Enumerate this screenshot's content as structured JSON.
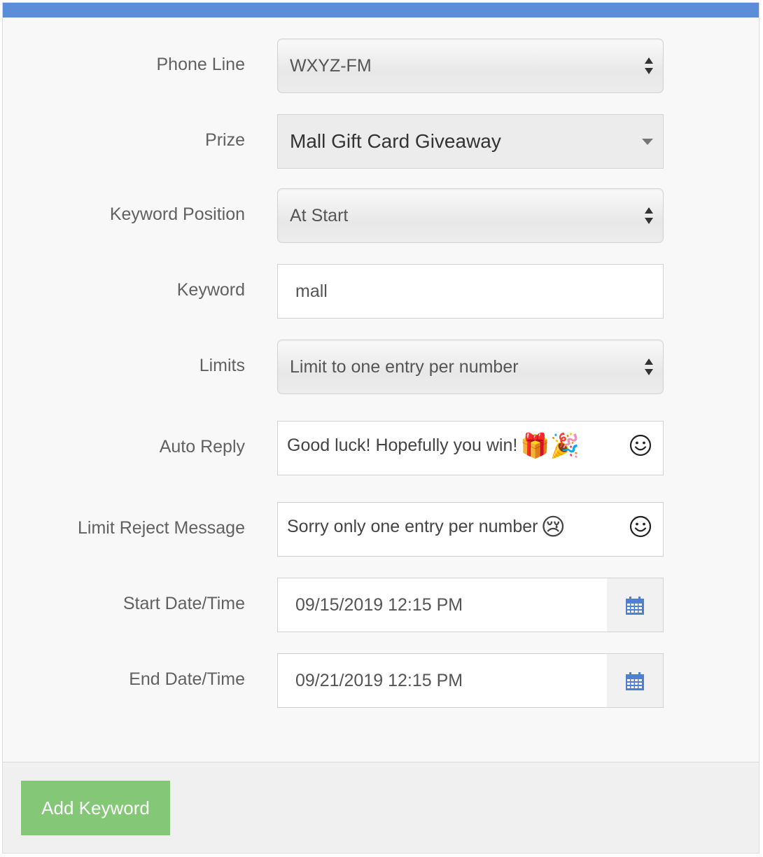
{
  "form": {
    "phone_line": {
      "label": "Phone Line",
      "value": "WXYZ-FM"
    },
    "prize": {
      "label": "Prize",
      "value": "Mall Gift Card Giveaway"
    },
    "keyword_position": {
      "label": "Keyword Position",
      "value": "At Start"
    },
    "keyword": {
      "label": "Keyword",
      "value": "mall"
    },
    "limits": {
      "label": "Limits",
      "value": "Limit to one entry per number"
    },
    "auto_reply": {
      "label": "Auto Reply",
      "value": "Good luck! Hopefully you win!",
      "emoji": "🎁🎉",
      "emoji_picker_icon": "smiley-icon"
    },
    "limit_reject": {
      "label": "Limit Reject Message",
      "value": "Sorry only one entry per number",
      "emoji": "😢",
      "emoji_picker_icon": "smiley-icon"
    },
    "start": {
      "label": "Start Date/Time",
      "value": "09/15/2019 12:15 PM",
      "icon": "calendar-icon"
    },
    "end": {
      "label": "End Date/Time",
      "value": "09/21/2019 12:15 PM",
      "icon": "calendar-icon"
    }
  },
  "footer": {
    "submit_label": "Add Keyword"
  },
  "colors": {
    "accent_bar": "#5b8dd9",
    "button": "#83c777",
    "calendar_icon": "#4f7fd1"
  }
}
